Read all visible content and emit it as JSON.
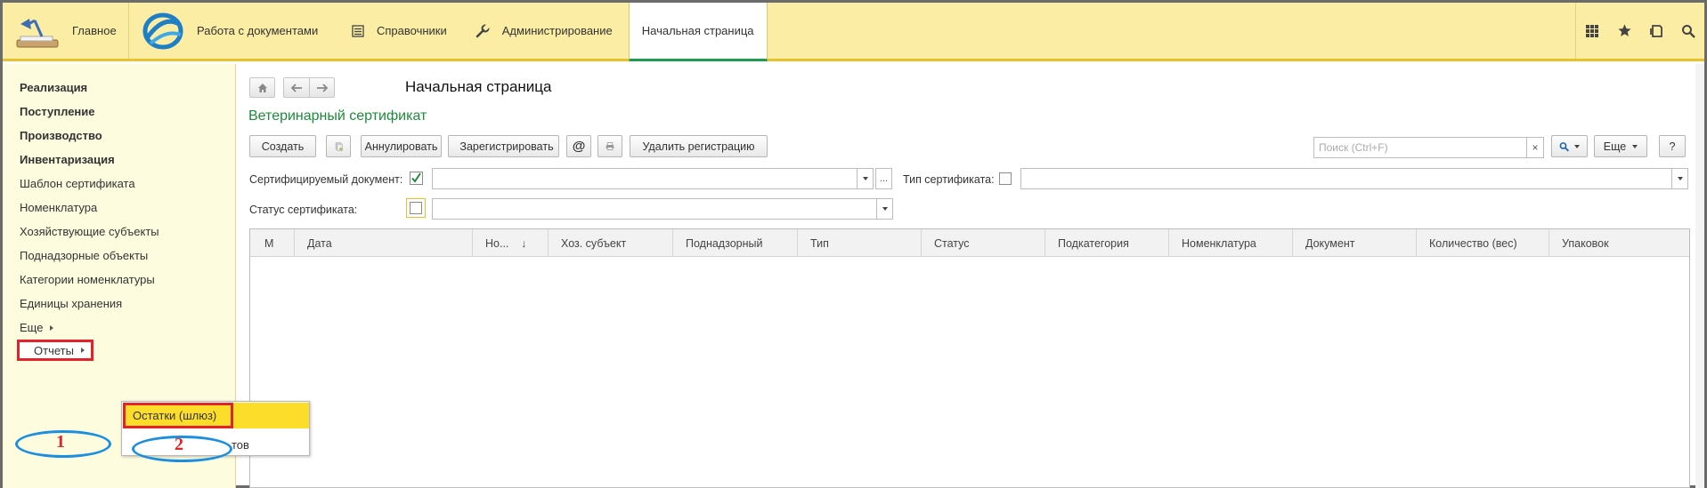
{
  "topbar": {
    "home_label": "Главное",
    "docs_label": "Работа с документами",
    "ref_label": "Справочники",
    "admin_label": "Администрирование",
    "start_tab_label": "Начальная страница",
    "icons": [
      "apps-grid-icon",
      "star-icon",
      "history-icon",
      "search-icon"
    ]
  },
  "sidebar": {
    "items": [
      {
        "label": "Реализация",
        "bold": true
      },
      {
        "label": "Поступление",
        "bold": true
      },
      {
        "label": "Производство",
        "bold": true
      },
      {
        "label": "Инвентаризация",
        "bold": true
      },
      {
        "label": "Шаблон сертификата",
        "bold": false
      },
      {
        "label": "Номенклатура",
        "bold": false
      },
      {
        "label": "Хозяйствующие субъекты",
        "bold": false
      },
      {
        "label": "Поднадзорные объекты",
        "bold": false
      },
      {
        "label": "Категории номенклатуры",
        "bold": false
      },
      {
        "label": "Единицы хранения",
        "bold": false
      }
    ],
    "more_label": "Еще",
    "reports_label": "Отчеты"
  },
  "popup": {
    "item1": "Остатки (шлюз)",
    "item2_visible": "тов"
  },
  "annotations": {
    "num1": "1",
    "num2": "2"
  },
  "main": {
    "page_title": "Начальная страница",
    "form_title": "Ветеринарный сертификат",
    "toolbar": {
      "create": "Создать",
      "annul": "Аннулировать",
      "register": "Зарегистрировать",
      "at": "@",
      "delete_registration": "Удалить регистрацию",
      "more": "Еще",
      "help": "?"
    },
    "search": {
      "placeholder": "Поиск (Ctrl+F)",
      "clear": "×"
    },
    "filters": {
      "cert_doc_label": "Сертифицируемый документ:",
      "cert_doc_checked": true,
      "cert_doc_ellipsis": "...",
      "cert_type_label": "Тип сертификата:",
      "cert_status_label": "Статус сертификата:"
    },
    "table": {
      "columns": [
        "М",
        "Дата",
        "Но...",
        "Хоз. субъект",
        "Поднадзорный",
        "Тип",
        "Статус",
        "Подкатегория",
        "Номенклатура",
        "Документ",
        "Количество (вес)",
        "Упаковок"
      ],
      "sort_indicator": "↓",
      "rows": []
    }
  },
  "colors": {
    "topbar_bg": "#fbeda3",
    "sidebar_bg": "#fefcde",
    "accent_green": "#1c8c3a",
    "highlight_yellow": "#fbdd2a",
    "annotation_red": "#e4222a",
    "annotation_blue": "#1a8fe0"
  }
}
